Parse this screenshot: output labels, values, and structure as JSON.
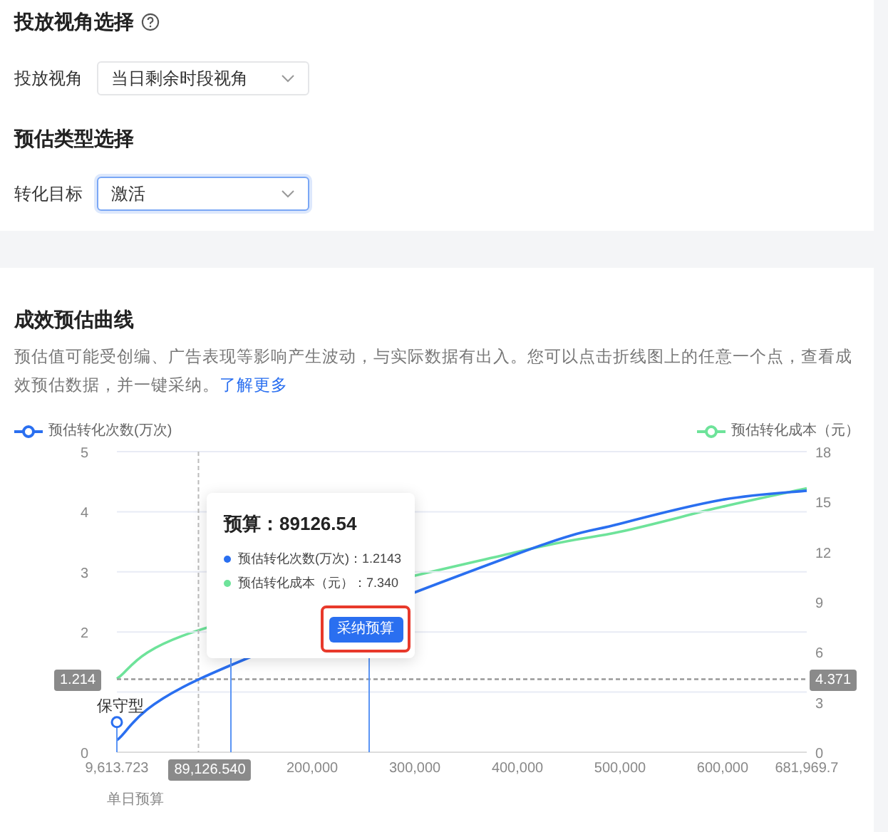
{
  "view_section": {
    "title": "投放视角选择",
    "field_label": "投放视角",
    "select_value": "当日剩余时段视角",
    "focused": false
  },
  "type_section": {
    "title": "预估类型选择",
    "field_label": "转化目标",
    "select_value": "激活",
    "focused": true
  },
  "curve_section": {
    "title": "成效预估曲线",
    "description": "预估值可能受创编、广告表现等影响产生波动，与实际数据有出入。您可以点击折线图上的任意一个点，查看成效预估数据，并一键采纳。",
    "link": "了解更多",
    "conversions_chart": {
      "chart_data": {
        "type": "line",
        "xlabel": "单日预算",
        "x": [
          9613.723,
          89126.54,
          200000,
          300000,
          400000,
          500000,
          600000,
          681969.7
        ],
        "series": [
          {
            "name": "预估转化次数(万次)",
            "color": "#2a6ff0",
            "values": [
              0.2,
              1.21,
              null,
              null,
              3.3,
              3.8,
              4.2,
              4.35
            ]
          }
        ],
        "xlim": [
          9613.723,
          681969.7
        ],
        "ylim": [
          0,
          5
        ],
        "grid": true,
        "xticks": [
          {
            "value": 9613.723,
            "label": "9,613.723"
          },
          {
            "value": 200000,
            "label": "200,000"
          },
          {
            "value": 300000,
            "label": "300,000"
          },
          {
            "value": 400000,
            "label": "400,000"
          },
          {
            "value": 500000,
            "label": "500,000"
          },
          {
            "value": 600000,
            "label": "600,000"
          },
          {
            "value": 681969.7,
            "label": "681,969.7"
          }
        ],
        "yticks": [
          0,
          2,
          3,
          4,
          5
        ],
        "ref_lines": [
          {
            "axis": "x",
            "value": 89126.54,
            "label": "89,126.540"
          },
          {
            "axis": "y",
            "value": 1.214,
            "label": "1.214"
          }
        ]
      }
    },
    "cost_chart": {
      "chart_data": {
        "type": "line",
        "x": [
          9613.723,
          89126.54,
          200000,
          300000,
          400000,
          500000,
          600000,
          681969.7
        ],
        "series": [
          {
            "name": "预估转化成本（元）",
            "color": "#6ee39a",
            "values": [
              4.4,
              7.3,
              null,
              null,
              12.0,
              13.2,
              14.7,
              15.8
            ]
          }
        ],
        "xlim": [
          9613.723,
          681969.7
        ],
        "ylim": [
          0,
          18
        ],
        "yticks": [
          0,
          3,
          6,
          9,
          12,
          15,
          18
        ],
        "ref_lines": [
          {
            "axis": "y",
            "value": 4.371,
            "label": "4.371"
          }
        ]
      }
    },
    "marker": {
      "label": "保守型"
    },
    "tooltip": {
      "title": "预算：89126.54",
      "rows": [
        {
          "label": "预估转化次数(万次)：1.2143",
          "color": "#2a6ff0"
        },
        {
          "label": "预估转化成本（元）：7.340",
          "color": "#6ee39a"
        }
      ],
      "button": "采纳预算"
    }
  }
}
